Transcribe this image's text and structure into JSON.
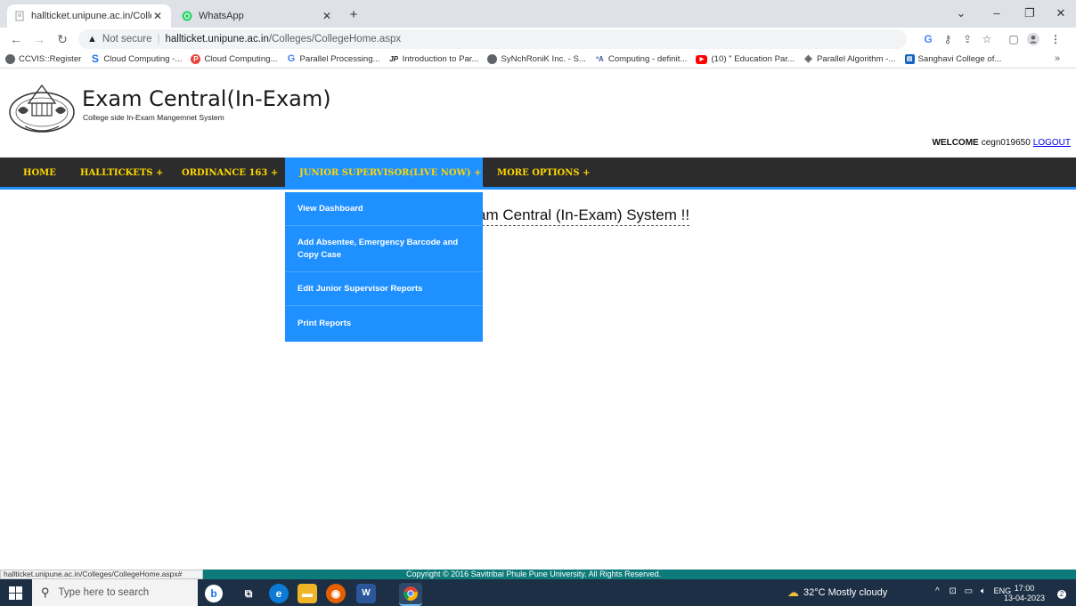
{
  "browser": {
    "tabs": [
      {
        "title": "hallticket.unipune.ac.in/Colleges",
        "active": true
      },
      {
        "title": "WhatsApp",
        "active": false
      }
    ],
    "new_tab": "+",
    "window_controls": {
      "minimize": "–",
      "restore": "❐",
      "close": "✕",
      "dropdown": "⌄"
    },
    "url": {
      "not_secure": "Not secure",
      "separator": "|",
      "host": "hallticket.unipune.ac.in",
      "path": "/Colleges/CollegeHome.aspx"
    },
    "bookmarks": [
      {
        "label": "CCVIS::Register",
        "color": "#5f6368",
        "icon": "globe-icon"
      },
      {
        "label": "Cloud Computing -...",
        "color": "#1a73e8",
        "icon": "s-icon"
      },
      {
        "label": "Cloud Computing...",
        "color": "#e8453c",
        "icon": "p-icon"
      },
      {
        "label": "Parallel Processing...",
        "color": "#4285f4",
        "icon": "google-icon"
      },
      {
        "label": "Introduction to Par...",
        "color": "#202124",
        "icon": "jp-icon"
      },
      {
        "label": "SyNchRoniK Inc. - S...",
        "color": "#5f6368",
        "icon": "globe-icon"
      },
      {
        "label": "Computing - definit...",
        "color": "#3b5998",
        "icon": "dict-icon"
      },
      {
        "label": "(10) \" Education Par...",
        "color": "#ff0000",
        "icon": "youtube-icon"
      },
      {
        "label": "Parallel Algorithm -...",
        "color": "#5f6368",
        "icon": "diamond-icon"
      },
      {
        "label": "Sanghavi College of...",
        "color": "#1565c0",
        "icon": "college-icon"
      }
    ],
    "bookmarks_more": "»"
  },
  "site": {
    "title": "Exam Central(In-Exam)",
    "subtitle": "College side In-Exam Mangemnet System",
    "welcome_label": "WELCOME",
    "username": "cegn019650",
    "logout": "LOGOUT",
    "nav": [
      {
        "label": "HOME"
      },
      {
        "label": "HALLTICKETS +"
      },
      {
        "label": "ORDINANCE 163 +"
      },
      {
        "label": "JUNIOR SUPERVISOR(LIVE NOW) +"
      },
      {
        "label": "MORE OPTIONS +"
      }
    ],
    "dropdown": [
      "View Dashboard",
      "Add Absentee, Emergency Barcode and Copy Case",
      "Edit Junior Supervisor Reports",
      "Print Reports"
    ],
    "welcome_heading": "am Central (In-Exam) System !!",
    "footer": "Copyright © 2016 Savitribai Phule Pune University. All Rights Reserved.",
    "status_url": "hallticket.unipune.ac.in/Colleges/CollegeHome.aspx#",
    "accent": "#1e90ff",
    "nav_text_color": "#ffd700"
  },
  "taskbar": {
    "search_placeholder": "Type here to search",
    "weather": "32°C  Mostly cloudy",
    "language": "ENG",
    "time": "17:00",
    "date": "13-04-2023",
    "notifications": "2"
  }
}
